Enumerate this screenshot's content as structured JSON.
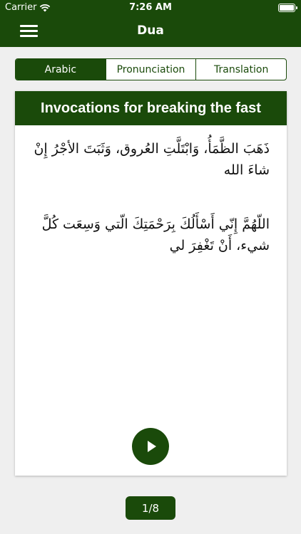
{
  "status_bar": {
    "carrier": "Carrier",
    "time": "7:26 AM"
  },
  "nav": {
    "title": "Dua",
    "menu_icon": "hamburger-menu-icon"
  },
  "tabs": [
    {
      "label": "Arabic",
      "selected": true
    },
    {
      "label": "Pronunciation",
      "selected": false
    },
    {
      "label": "Translation",
      "selected": false
    }
  ],
  "card": {
    "title": "Invocations for breaking the fast",
    "dua_1": "ذَهَبَ الظَّمَأُ، وَابْتَلَّتِ العُروق، وَثَبَتَ الأجْرُ إِنْ شاءَ الله",
    "dua_2": "اللّهُمَّ إِنّي أَسْأَلُكَ بِرَحْمَتِكَ الّتي وَسِعَت كُلَّ شيء، أَنْ تَغْفِرَ لي",
    "play_icon": "play-icon"
  },
  "pager": {
    "text": "1/8"
  },
  "colors": {
    "primary": "#1a4a0a",
    "background": "#efefef",
    "card": "#ffffff"
  }
}
